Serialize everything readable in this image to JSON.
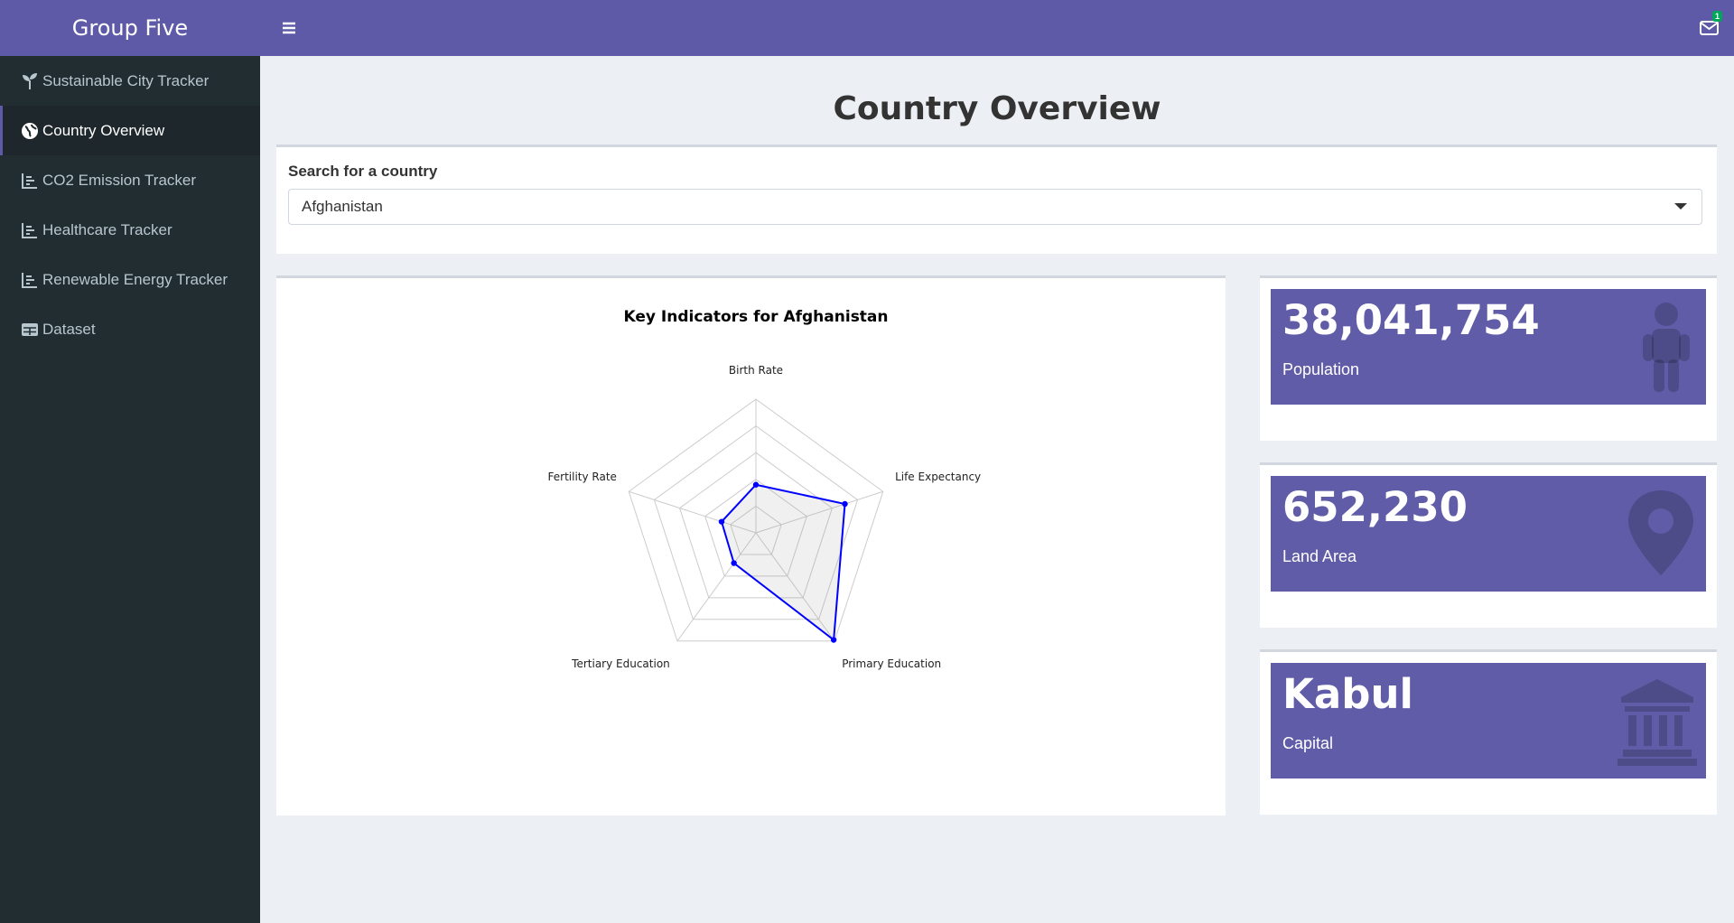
{
  "brand": "Group Five",
  "sidebar": {
    "items": [
      {
        "label": "Sustainable City Tracker",
        "icon": "seedling-icon",
        "active": false
      },
      {
        "label": "Country Overview",
        "icon": "globe-icon",
        "active": true
      },
      {
        "label": "CO2 Emission Tracker",
        "icon": "line-chart-icon",
        "active": false
      },
      {
        "label": "Healthcare Tracker",
        "icon": "line-chart-icon",
        "active": false
      },
      {
        "label": "Renewable Energy Tracker",
        "icon": "line-chart-icon",
        "active": false
      },
      {
        "label": "Dataset",
        "icon": "table-icon",
        "active": false
      }
    ]
  },
  "header": {
    "menu_icon": "hamburger-icon",
    "notifications_icon": "envelope-icon",
    "notification_count": "1"
  },
  "page_title": "Country Overview",
  "search": {
    "label": "Search for a country",
    "selected": "Afghanistan"
  },
  "colors": {
    "brand": "#5f5aa8",
    "sidebar": "#222d32",
    "tile": "#605ca8",
    "series": "#0000ff"
  },
  "chart_data": {
    "type": "radar",
    "title": "Key Indicators for Afghanistan",
    "categories": [
      "Birth Rate",
      "Life Expectancy",
      "Primary Education",
      "Tertiary Education",
      "Fertility Rate"
    ],
    "values": [
      0.36,
      0.7,
      0.99,
      0.28,
      0.27
    ],
    "range": [
      0,
      1
    ],
    "grid_levels": 5,
    "legend": "none"
  },
  "stats": [
    {
      "value": "38,041,754",
      "label": "Population",
      "icon": "child-icon"
    },
    {
      "value": "652,230",
      "label": "Land Area",
      "icon": "map-marker-icon"
    },
    {
      "value": "Kabul",
      "label": "Capital",
      "icon": "university-icon"
    }
  ]
}
